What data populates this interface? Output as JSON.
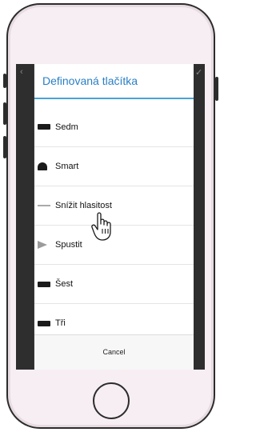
{
  "dialog": {
    "title": "Definovaná tlačítka",
    "items": [
      {
        "label": "Sedm",
        "icon": "remote-button-icon"
      },
      {
        "label": "Smart",
        "icon": "smart-icon"
      },
      {
        "label": "Snížit hlasitost",
        "icon": "volume-down-icon"
      },
      {
        "label": "Spustit",
        "icon": "play-icon"
      },
      {
        "label": "Šest",
        "icon": "remote-button-icon"
      },
      {
        "label": "Tři",
        "icon": "remote-button-icon"
      }
    ],
    "cancel_label": "Cancel"
  },
  "colors": {
    "title": "#2a7fc3",
    "divider": "#47a3d9",
    "phone_frame": "#f7eef3"
  }
}
